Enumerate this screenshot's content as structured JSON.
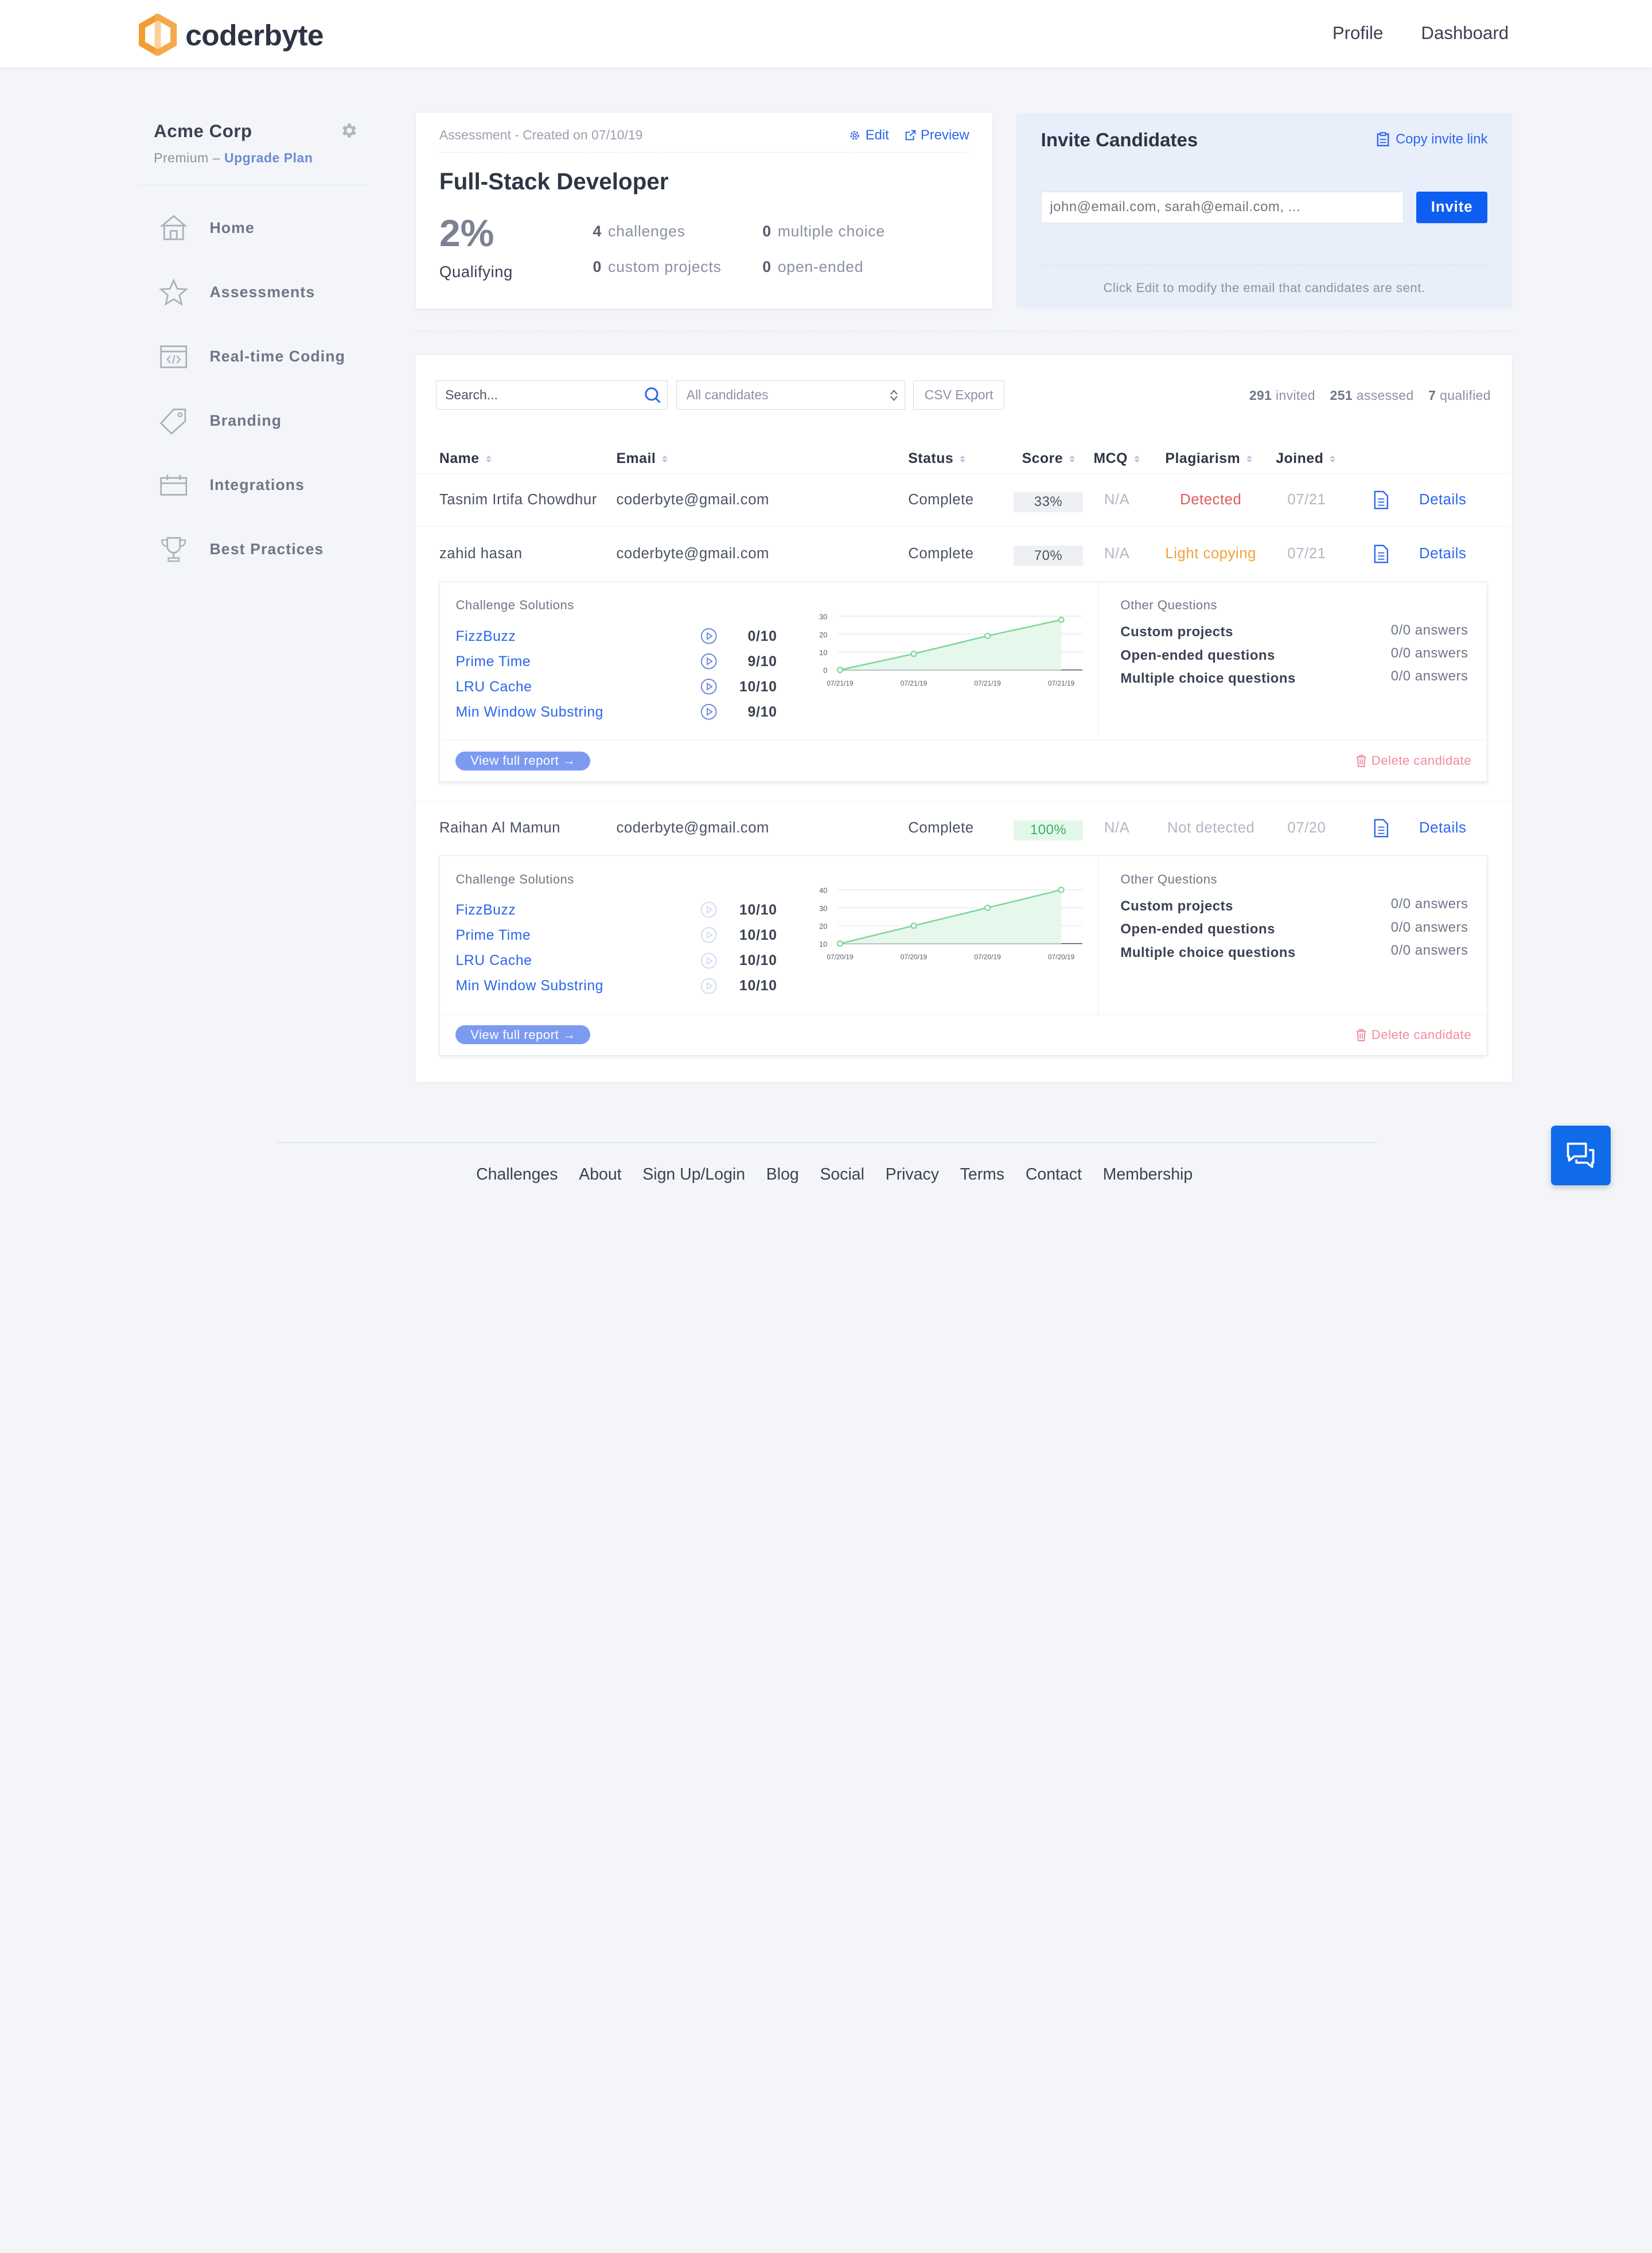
{
  "brand": {
    "name": "coderbyte",
    "accent": "#f39c34"
  },
  "topnav": [
    "Profile",
    "Dashboard"
  ],
  "sidebar": {
    "org_name": "Acme Corp",
    "plan": "Premium",
    "plan_sep": "–",
    "upgrade": "Upgrade Plan",
    "items": [
      {
        "label": "Home",
        "icon": "home-icon"
      },
      {
        "label": "Assessments",
        "icon": "star-icon"
      },
      {
        "label": "Real-time Coding",
        "icon": "code-window-icon"
      },
      {
        "label": "Branding",
        "icon": "tag-icon"
      },
      {
        "label": "Integrations",
        "icon": "calendar-icon"
      },
      {
        "label": "Best Practices",
        "icon": "trophy-icon"
      }
    ]
  },
  "assessment": {
    "meta": "Assessment - Created on 07/10/19",
    "edit": "Edit",
    "preview": "Preview",
    "title": "Full-Stack Developer",
    "percent": "2%",
    "percent_label": "Qualifying",
    "stats": [
      {
        "n": "4",
        "label": "challenges"
      },
      {
        "n": "0",
        "label": "multiple choice"
      },
      {
        "n": "0",
        "label": "custom projects"
      },
      {
        "n": "0",
        "label": "open-ended"
      }
    ]
  },
  "invite": {
    "title": "Invite Candidates",
    "copy_link": "Copy invite link",
    "placeholder": "john@email.com, sarah@email.com, ...",
    "button": "Invite",
    "note": "Click Edit to modify the email that candidates are sent."
  },
  "toolbar": {
    "search_placeholder": "Search...",
    "filter": "All candidates",
    "csv": "CSV Export",
    "invited_n": "291",
    "invited": "invited",
    "assessed_n": "251",
    "assessed": "assessed",
    "qualified_n": "7",
    "qualified": "qualified"
  },
  "columns": [
    "Name",
    "Email",
    "Status",
    "Score",
    "MCQ",
    "Plagiarism",
    "Joined"
  ],
  "rows": [
    {
      "name": "Tasnim Irtifa Chowdhur",
      "email": "coderbyte@gmail.com",
      "status": "Complete",
      "score": "33%",
      "mcq": "N/A",
      "plagiarism": "Detected",
      "joined": "07/21",
      "details": "Details"
    },
    {
      "name": "zahid hasan",
      "email": "coderbyte@gmail.com",
      "status": "Complete",
      "score": "70%",
      "mcq": "N/A",
      "plagiarism": "Light copying",
      "joined": "07/21",
      "details": "Details"
    },
    {
      "name": "Raihan Al Mamun",
      "email": "coderbyte@gmail.com",
      "status": "Complete",
      "score": "100%",
      "mcq": "N/A",
      "plagiarism": "Not detected",
      "joined": "07/20",
      "details": "Details"
    }
  ],
  "details": [
    {
      "section": "Challenge Solutions",
      "solutions": [
        {
          "name": "FizzBuzz",
          "score": "0/10"
        },
        {
          "name": "Prime Time",
          "score": "9/10"
        },
        {
          "name": "LRU Cache",
          "score": "10/10"
        },
        {
          "name": "Min Window Substring",
          "score": "9/10"
        }
      ],
      "other_title": "Other Questions",
      "other": [
        {
          "label": "Custom projects",
          "value": "0/0 answers"
        },
        {
          "label": "Open-ended questions",
          "value": "0/0 answers"
        },
        {
          "label": "Multiple choice questions",
          "value": "0/0 answers"
        }
      ],
      "report": "View full report →",
      "delete": "Delete candidate"
    },
    {
      "section": "Challenge Solutions",
      "solutions": [
        {
          "name": "FizzBuzz",
          "score": "10/10"
        },
        {
          "name": "Prime Time",
          "score": "10/10"
        },
        {
          "name": "LRU Cache",
          "score": "10/10"
        },
        {
          "name": "Min Window Substring",
          "score": "10/10"
        }
      ],
      "other_title": "Other Questions",
      "other": [
        {
          "label": "Custom projects",
          "value": "0/0 answers"
        },
        {
          "label": "Open-ended questions",
          "value": "0/0 answers"
        },
        {
          "label": "Multiple choice questions",
          "value": "0/0 answers"
        }
      ],
      "report": "View full report →",
      "delete": "Delete candidate"
    }
  ],
  "chart_data": [
    {
      "type": "area",
      "categories": [
        "07/21/19",
        "07/21/19",
        "07/21/19",
        "07/21/19"
      ],
      "values": [
        0,
        9,
        19,
        28
      ],
      "yticks": [
        "0",
        "10",
        "20",
        "30"
      ],
      "ylim": [
        0,
        30
      ],
      "color": "#7fd79a"
    },
    {
      "type": "area",
      "categories": [
        "07/20/19",
        "07/20/19",
        "07/20/19",
        "07/20/19"
      ],
      "values": [
        10,
        20,
        30,
        40
      ],
      "yticks": [
        "10",
        "20",
        "30",
        "40"
      ],
      "ylim": [
        10,
        40
      ],
      "color": "#7fd79a"
    }
  ],
  "footer": [
    "Challenges",
    "About",
    "Sign Up/Login",
    "Blog",
    "Social",
    "Privacy",
    "Terms",
    "Contact",
    "Membership"
  ]
}
